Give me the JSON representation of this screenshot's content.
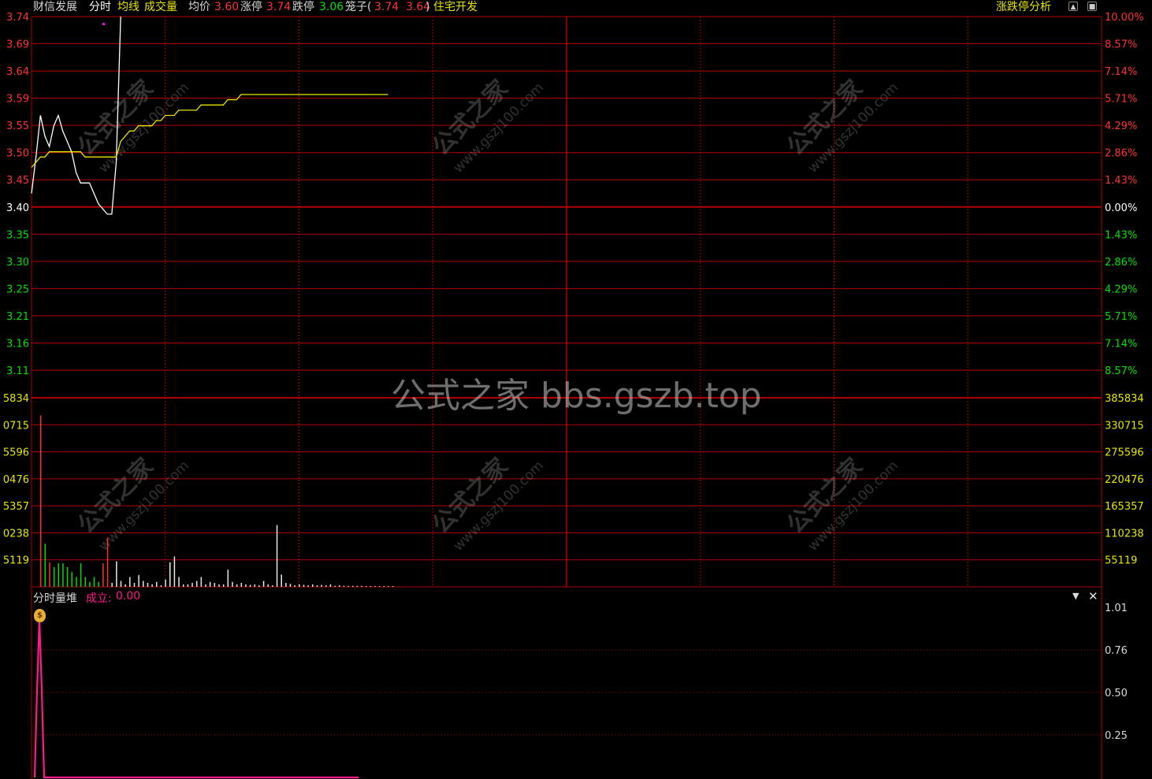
{
  "header": {
    "stock_name": "财信发展",
    "tab_intraday": "分时",
    "label_avgline": "均线",
    "label_volume": "成交量",
    "label_avgprice": "均价",
    "avg_price": "3.60",
    "label_limitup": "涨停",
    "limit_up": "3.74",
    "label_limitdown": "跌停",
    "limit_down": "3.06",
    "cage_label": "笼子(",
    "cage_values": "3.74  3.64",
    "cage_close": ")",
    "sector": "住宅开发",
    "analysis_link": "涨跌停分析"
  },
  "watermarks": {
    "center": "公式之家 bbs.gszb.top",
    "tile_cn": "公式之家",
    "tile_url": "www.gszj100.com"
  },
  "indicator": {
    "name": "分时量堆",
    "param_label": "成立:",
    "param_value": "0.00",
    "y_labels": [
      "1.01",
      "0.76",
      "0.50",
      "0.25"
    ]
  },
  "colors": {
    "grid": "#b00000",
    "up": "#ff3232",
    "down": "#00e000",
    "price_line": "#ffffff",
    "avg_line": "#e6e600",
    "indicator_line": "#ff1a8c"
  },
  "chart_data": [
    {
      "type": "line",
      "panel": "price",
      "prev_close": 3.4,
      "ylim": [
        3.06,
        3.74
      ],
      "y_ticks_left": [
        "3.74",
        "3.69",
        "3.64",
        "3.59",
        "3.55",
        "3.50",
        "3.45",
        "3.40",
        "3.35",
        "3.30",
        "3.25",
        "3.21",
        "3.16",
        "3.11"
      ],
      "y_ticks_right": [
        "10.00%",
        "8.57%",
        "7.14%",
        "5.71%",
        "4.29%",
        "2.86%",
        "1.43%",
        "0.00%",
        "1.43%",
        "2.86%",
        "4.29%",
        "5.71%",
        "7.14%",
        "8.57%"
      ],
      "series": [
        {
          "values": [
            3.4,
            3.47,
            3.55,
            3.51,
            3.49,
            3.53,
            3.55,
            3.52,
            3.5,
            3.48,
            3.44,
            3.42,
            3.42,
            3.42,
            3.4,
            3.38,
            3.37,
            3.36,
            3.36,
            3.46,
            3.74,
            3.74,
            3.74,
            3.74,
            3.74,
            3.74,
            3.74,
            3.74,
            3.74,
            3.74,
            3.74,
            3.74,
            3.74,
            3.74,
            3.74,
            3.74,
            3.74,
            3.74,
            3.74,
            3.74,
            3.74,
            3.74,
            3.74,
            3.74,
            3.74,
            3.74,
            3.74,
            3.74,
            3.74,
            3.74,
            3.74,
            3.74,
            3.74,
            3.74,
            3.74,
            3.74,
            3.74,
            3.74,
            3.74,
            3.74,
            3.74,
            3.74,
            3.74,
            3.74,
            3.74,
            3.74,
            3.74,
            3.74,
            3.74,
            3.74,
            3.74,
            3.74,
            3.74,
            3.74,
            3.74,
            3.74,
            3.74,
            3.74,
            3.74,
            3.74,
            3.74
          ]
        },
        {
          "values": [
            3.45,
            3.46,
            3.47,
            3.47,
            3.48,
            3.48,
            3.48,
            3.48,
            3.48,
            3.48,
            3.48,
            3.48,
            3.47,
            3.47,
            3.47,
            3.47,
            3.47,
            3.47,
            3.47,
            3.47,
            3.5,
            3.51,
            3.52,
            3.52,
            3.53,
            3.53,
            3.53,
            3.53,
            3.54,
            3.54,
            3.55,
            3.55,
            3.55,
            3.56,
            3.56,
            3.56,
            3.56,
            3.56,
            3.57,
            3.57,
            3.57,
            3.57,
            3.57,
            3.57,
            3.58,
            3.58,
            3.58,
            3.59,
            3.59,
            3.59,
            3.59,
            3.59,
            3.59,
            3.59,
            3.59,
            3.59,
            3.59,
            3.59,
            3.59,
            3.59,
            3.59,
            3.59,
            3.59,
            3.59,
            3.59,
            3.59,
            3.59,
            3.59,
            3.59,
            3.59,
            3.59,
            3.59,
            3.59,
            3.59,
            3.59,
            3.59,
            3.59,
            3.59,
            3.59,
            3.59,
            3.59
          ]
        }
      ]
    },
    {
      "type": "bar",
      "panel": "volume",
      "ylim": [
        0,
        385834
      ],
      "y_ticks_left": [
        "5834",
        "0715",
        "5596",
        "0476",
        "5357",
        "0238",
        "5119"
      ],
      "y_ticks_right": [
        "385834",
        "330715",
        "275596",
        "220476",
        "165357",
        "110238",
        "55119"
      ],
      "values": [
        0,
        350000,
        88000,
        50000,
        40000,
        48000,
        48000,
        40000,
        30000,
        20000,
        48000,
        20000,
        10000,
        20000,
        10000,
        48000,
        100000,
        8000,
        52000,
        12000,
        5000,
        20000,
        8000,
        24000,
        12000,
        8000,
        5000,
        10000,
        3000,
        15000,
        50000,
        62000,
        20000,
        5000,
        5000,
        8000,
        12000,
        20000,
        5000,
        10000,
        8000,
        5000,
        5000,
        35000,
        10000,
        5000,
        8000,
        5000,
        4000,
        5000,
        3000,
        12000,
        5000,
        3000,
        126000,
        25000,
        8000,
        6000,
        3000,
        5000,
        4000,
        3000,
        5000,
        3000,
        4000,
        3000,
        5000,
        2000,
        3000,
        2000,
        2000,
        2000,
        2000,
        2000,
        1500,
        1500,
        1500,
        1500,
        1500,
        1500,
        1500
      ],
      "colors": [
        "u",
        "u",
        "d",
        "u",
        "d",
        "d",
        "d",
        "d",
        "d",
        "d",
        "d",
        "d",
        "d",
        "d",
        "d",
        "u",
        "u",
        "w",
        "w",
        "w",
        "w",
        "w",
        "w",
        "w",
        "w",
        "w",
        "w",
        "w",
        "w",
        "w",
        "w",
        "w",
        "w",
        "w",
        "w",
        "w",
        "w",
        "w",
        "w",
        "w",
        "w",
        "w",
        "w",
        "w",
        "w",
        "w",
        "w",
        "w",
        "w",
        "w",
        "w",
        "w",
        "w",
        "w",
        "w",
        "w",
        "w",
        "w",
        "w",
        "w",
        "w",
        "w",
        "w",
        "w",
        "w",
        "w",
        "w",
        "w",
        "w",
        "w",
        "w",
        "w",
        "w",
        "w",
        "w",
        "w",
        "w",
        "w",
        "w",
        "w",
        "w"
      ]
    },
    {
      "type": "line",
      "panel": "indicator",
      "ylim": [
        0,
        1.01
      ],
      "values": [
        0,
        0.55,
        1.0,
        0.55,
        0,
        0,
        0,
        0,
        0,
        0,
        0,
        0,
        0,
        0,
        0,
        0,
        0,
        0,
        0,
        0,
        0,
        0,
        0,
        0,
        0,
        0,
        0,
        0,
        0,
        0,
        0,
        0,
        0,
        0,
        0,
        0,
        0,
        0,
        0,
        0,
        0,
        0,
        0,
        0,
        0,
        0,
        0,
        0,
        0,
        0,
        0,
        0,
        0,
        0,
        0,
        0,
        0,
        0,
        0,
        0,
        0,
        0,
        0,
        0,
        0,
        0,
        0,
        0,
        0,
        0,
        0,
        0,
        0,
        0,
        0,
        0,
        0,
        0,
        0,
        0,
        0,
        0,
        0,
        0,
        0,
        0,
        0,
        0,
        0,
        0,
        0,
        0,
        0,
        0,
        0,
        0,
        0,
        0,
        0,
        0,
        0,
        0,
        0,
        0,
        0,
        0,
        0,
        0,
        0,
        0,
        0,
        0,
        0,
        0,
        0,
        0,
        0,
        0,
        0,
        0,
        0,
        0,
        0,
        0,
        0,
        0,
        0,
        0,
        0,
        0,
        0,
        0,
        0,
        0,
        0,
        0,
        0,
        0
      ]
    }
  ]
}
